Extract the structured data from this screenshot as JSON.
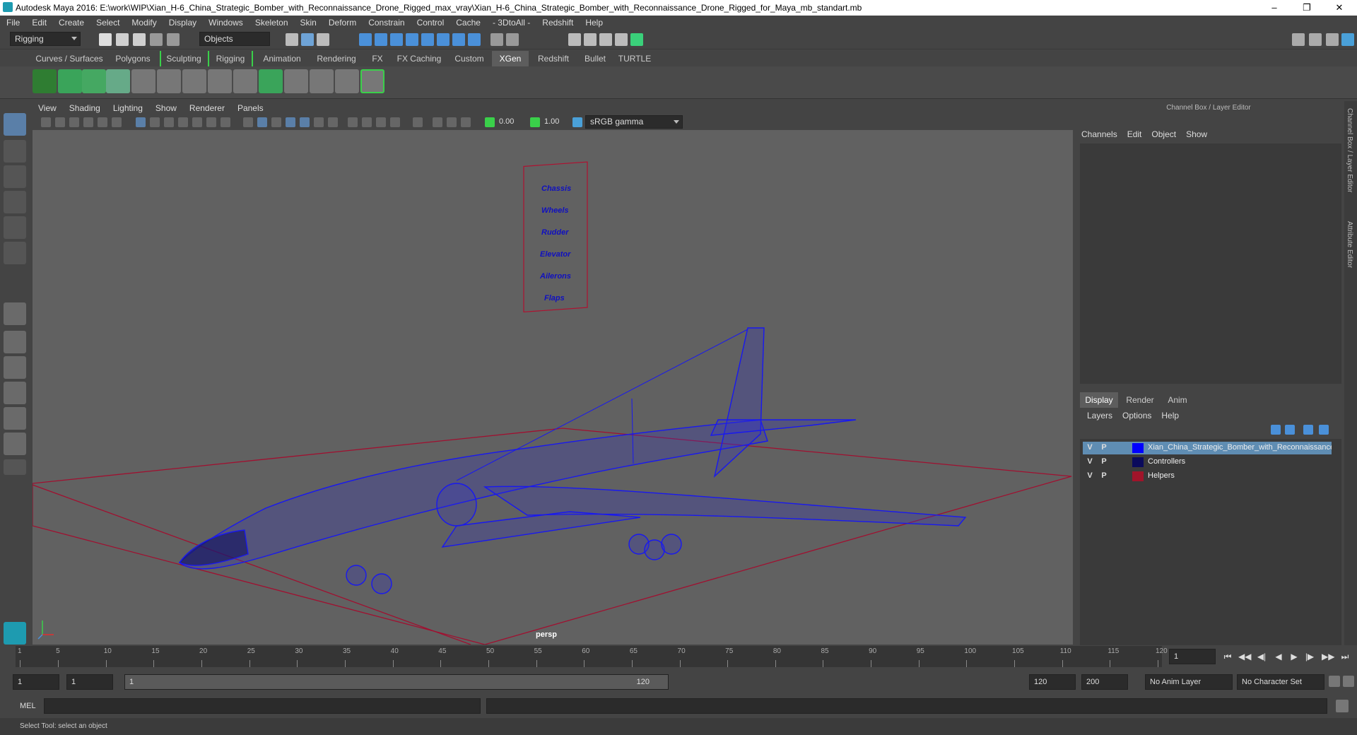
{
  "window": {
    "title": "Autodesk Maya 2016: E:\\work\\WIP\\Xian_H-6_China_Strategic_Bomber_with_Reconnaissance_Drone_Rigged_max_vray\\Xian_H-6_China_Strategic_Bomber_with_Reconnaissance_Drone_Rigged_for_Maya_mb_standart.mb"
  },
  "menubar": [
    "File",
    "Edit",
    "Create",
    "Select",
    "Modify",
    "Display",
    "Windows",
    "Skeleton",
    "Skin",
    "Deform",
    "Constrain",
    "Control",
    "Cache",
    "- 3DtoAll -",
    "Redshift",
    "Help"
  ],
  "statusline": {
    "menuset": "Rigging",
    "selection_mode": "Objects"
  },
  "shelf_tabs": [
    "Curves / Surfaces",
    "Polygons",
    "Sculpting",
    "Rigging",
    "Animation",
    "Rendering",
    "FX",
    "FX Caching",
    "Custom",
    "XGen",
    "Redshift",
    "Bullet",
    "TURTLE"
  ],
  "shelf_active": "XGen",
  "viewport": {
    "menu": [
      "View",
      "Shading",
      "Lighting",
      "Show",
      "Renderer",
      "Panels"
    ],
    "near_value": "0.00",
    "far_value": "1.00",
    "color_space": "sRGB gamma",
    "camera": "persp",
    "controller_labels": [
      "Chassis",
      "Wheels",
      "Rudder",
      "Elevator",
      "Ailerons",
      "Flaps"
    ]
  },
  "channel_box": {
    "title": "Channel Box / Layer Editor",
    "menu": [
      "Channels",
      "Edit",
      "Object",
      "Show"
    ]
  },
  "layer_editor": {
    "tabs": [
      "Display",
      "Render",
      "Anim"
    ],
    "menu": [
      "Layers",
      "Options",
      "Help"
    ],
    "layers": [
      {
        "v": "V",
        "p": "P",
        "name": "Xian_China_Strategic_Bomber_with_Reconnaissance_Drone",
        "color": "#0000ff"
      },
      {
        "v": "V",
        "p": "P",
        "name": "Controllers",
        "color": "#0a0a5c"
      },
      {
        "v": "V",
        "p": "P",
        "name": "Helpers",
        "color": "#a0142a"
      }
    ]
  },
  "side_tabs": [
    "Channel Box / Layer Editor",
    "Attribute Editor"
  ],
  "timeline": {
    "ticks": [
      "1",
      "5",
      "10",
      "15",
      "20",
      "25",
      "30",
      "35",
      "40",
      "45",
      "50",
      "55",
      "60",
      "65",
      "70",
      "75",
      "80",
      "85",
      "90",
      "95",
      "100",
      "105",
      "110",
      "115",
      "120"
    ],
    "current_frame": "1"
  },
  "range": {
    "start": "1",
    "playback_start": "1",
    "slider_start": "1",
    "slider_end": "120",
    "playback_end": "120",
    "end": "200",
    "anim_layer": "No Anim Layer",
    "character_set": "No Character Set"
  },
  "command_line": {
    "label": "MEL"
  },
  "help_line": "Select Tool: select an object"
}
